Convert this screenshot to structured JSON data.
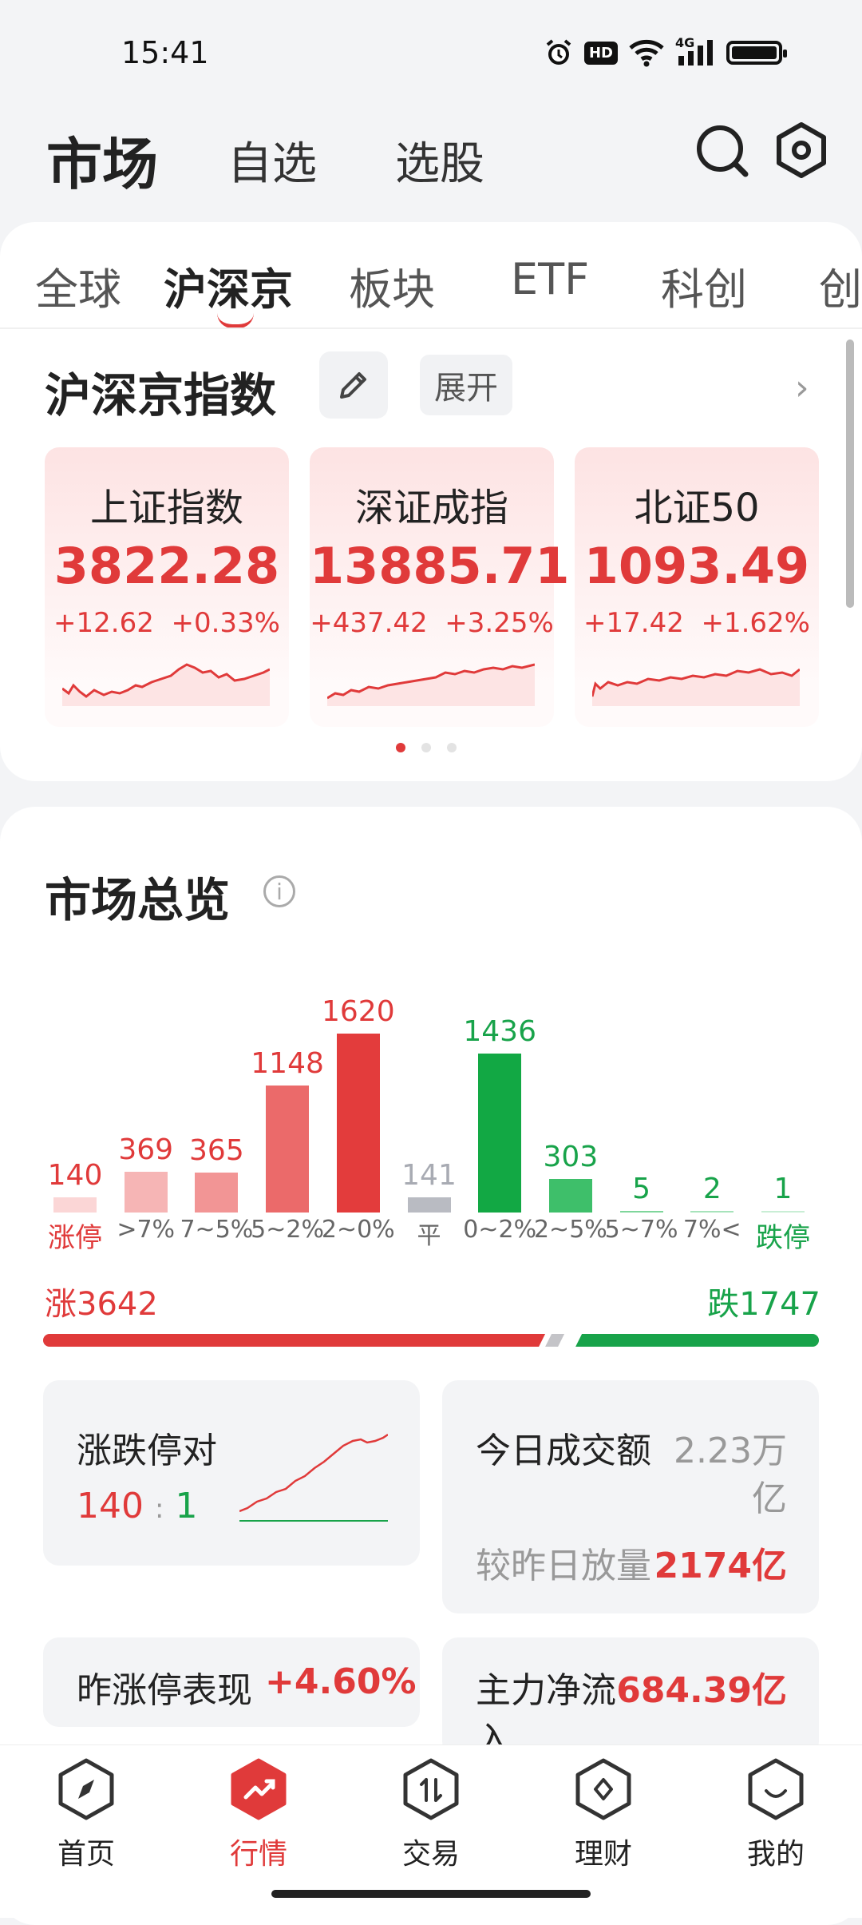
{
  "status_bar": {
    "time": "15:41",
    "hd_label": "HD",
    "net_label": "4G"
  },
  "header": {
    "title": "市场",
    "tabs": [
      "自选",
      "选股"
    ]
  },
  "market_tabs": {
    "items": [
      "全球",
      "沪深京",
      "板块",
      "ETF",
      "科创",
      "创"
    ],
    "active": "沪深京"
  },
  "indices_section": {
    "title": "沪深京指数",
    "expand_label": "展开",
    "cards": [
      {
        "name": "上证指数",
        "value": "3822.28",
        "change": "+12.62",
        "pct": "+0.33%"
      },
      {
        "name": "深证成指",
        "value": "13885.71",
        "change": "+437.42",
        "pct": "+3.25%"
      },
      {
        "name": "北证50",
        "value": "1093.49",
        "change": "+17.42",
        "pct": "+1.62%"
      }
    ],
    "pager": {
      "pages": 3,
      "current": 1
    }
  },
  "overview": {
    "title": "市场总览",
    "info_glyph": "i",
    "distribution": [
      {
        "label": "涨停",
        "value": "140",
        "color": "#fbd6d6",
        "tone": "red"
      },
      {
        "label": ">7%",
        "value": "369",
        "color": "#f6b5b5",
        "tone": "red"
      },
      {
        "label": "7~5%",
        "value": "365",
        "color": "#f29595",
        "tone": "red"
      },
      {
        "label": "5~2%",
        "value": "1148",
        "color": "#eb6a6a",
        "tone": "red"
      },
      {
        "label": "2~0%",
        "value": "1620",
        "color": "#e33c3c",
        "tone": "red"
      },
      {
        "label": "平",
        "value": "141",
        "color": "#b9bbc2",
        "tone": "grey"
      },
      {
        "label": "0~2%",
        "value": "1436",
        "color": "#12a844",
        "tone": "green"
      },
      {
        "label": "2~5%",
        "value": "303",
        "color": "#3ebf6a",
        "tone": "green"
      },
      {
        "label": "5~7%",
        "value": "5",
        "color": "#7fd69b",
        "tone": "green"
      },
      {
        "label": "7%<",
        "value": "2",
        "color": "#a7e3bb",
        "tone": "green"
      },
      {
        "label": "跌停",
        "value": "1",
        "color": "#c9eed5",
        "tone": "green"
      }
    ],
    "rise_total": "涨3642",
    "fall_total": "跌1747",
    "limit_pair": {
      "title": "涨跌停对",
      "up": "140",
      "sep": ":",
      "down": "1"
    },
    "turnover": {
      "title": "今日成交额",
      "value_line1": "2.23万",
      "value_line2": "亿",
      "compare_label": "较昨日放量",
      "compare_value": "2174亿"
    },
    "prev_limit": {
      "title": "昨涨停表现",
      "value": "+4.60%"
    },
    "main_flow": {
      "title_line1": "主力净流",
      "title_line2": "入",
      "value": "684.39亿"
    }
  },
  "bottom_nav": {
    "items": [
      {
        "label": "首页",
        "icon": "compass-icon"
      },
      {
        "label": "行情",
        "icon": "trend-icon"
      },
      {
        "label": "交易",
        "icon": "trade-icon"
      },
      {
        "label": "理财",
        "icon": "wealth-icon"
      },
      {
        "label": "我的",
        "icon": "profile-icon"
      }
    ],
    "active": "行情"
  },
  "colors": {
    "up": "#e03a3a",
    "down": "#18a34a",
    "accent": "#e03a3a"
  }
}
